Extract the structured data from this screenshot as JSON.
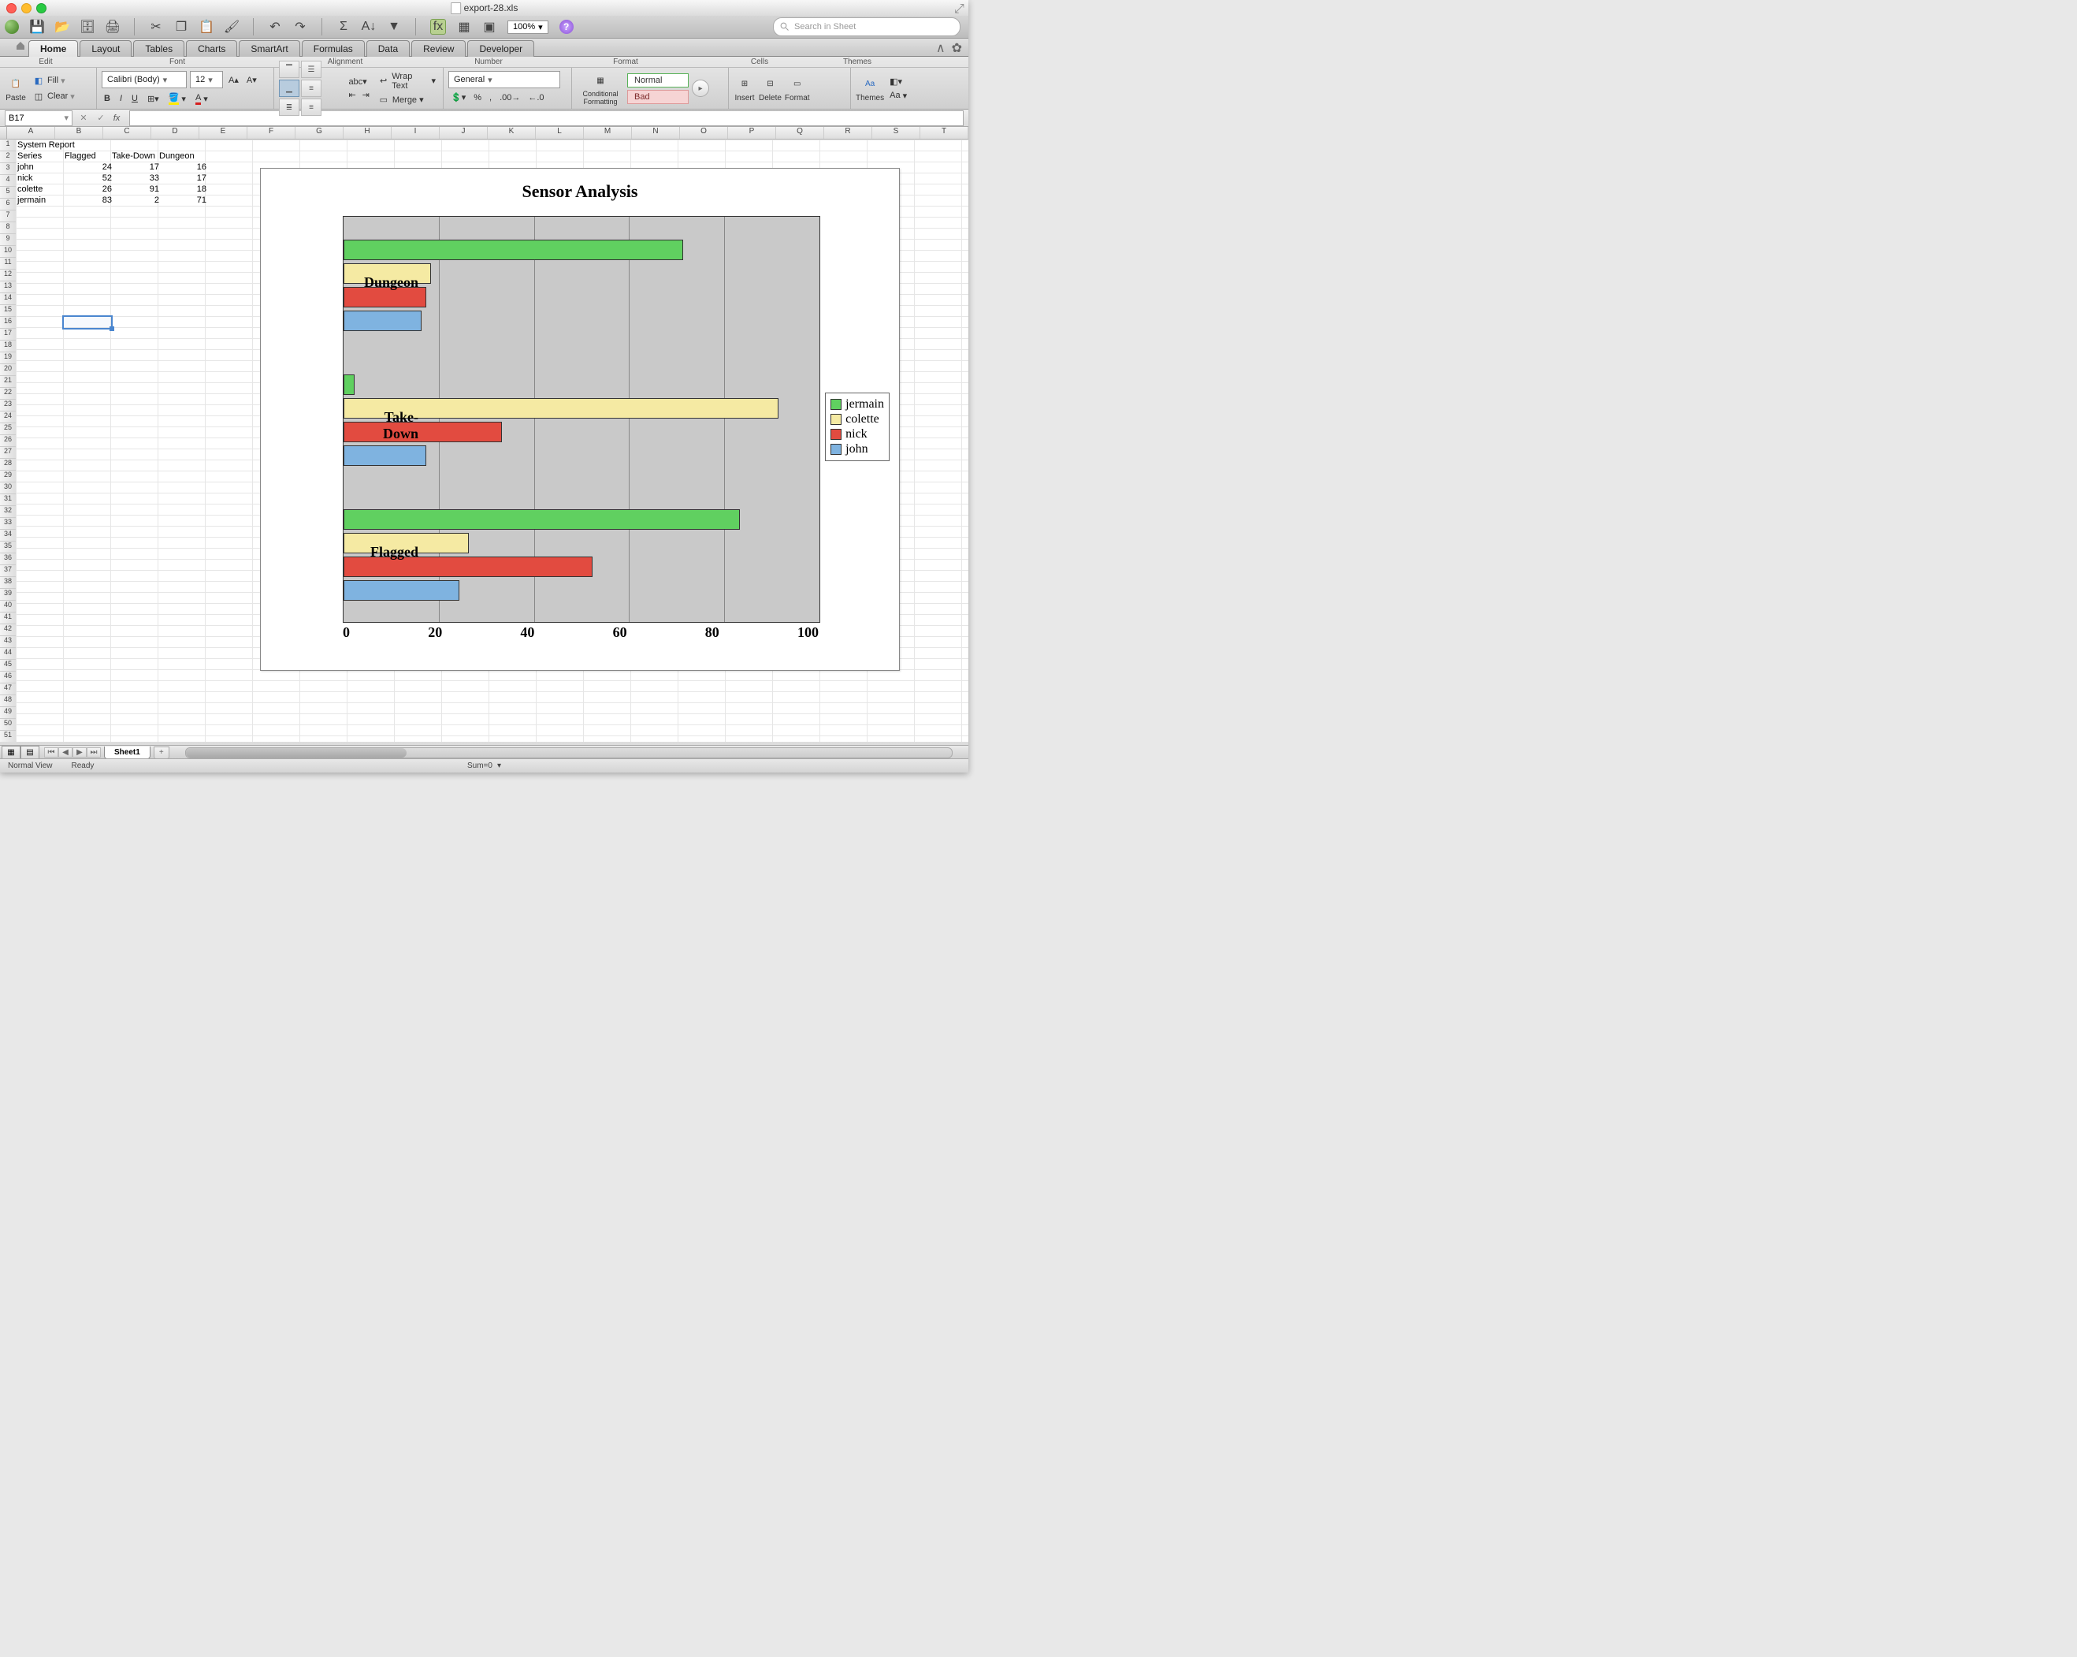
{
  "window": {
    "filename": "export-28.xls",
    "zoom": "100%",
    "search_placeholder": "Search in Sheet"
  },
  "tabs": [
    "Home",
    "Layout",
    "Tables",
    "Charts",
    "SmartArt",
    "Formulas",
    "Data",
    "Review",
    "Developer"
  ],
  "active_tab": "Home",
  "ribbon_groups": [
    "Edit",
    "Font",
    "Alignment",
    "Number",
    "Format",
    "Cells",
    "Themes"
  ],
  "ribbon": {
    "paste": "Paste",
    "fill": "Fill",
    "clear": "Clear",
    "font_name": "Calibri (Body)",
    "font_size": "12",
    "wrap": "Wrap Text",
    "merge": "Merge",
    "number_format": "General",
    "cond": "Conditional Formatting",
    "style_normal": "Normal",
    "style_bad": "Bad",
    "insert": "Insert",
    "delete": "Delete",
    "format": "Format",
    "themes": "Themes",
    "aa": "Aa"
  },
  "cell_ref": "B17",
  "selection": {
    "col": 1,
    "row": 16
  },
  "columns": [
    "A",
    "B",
    "C",
    "D",
    "E",
    "F",
    "G",
    "H",
    "I",
    "J",
    "K",
    "L",
    "M",
    "N",
    "O",
    "P",
    "Q",
    "R",
    "S",
    "T"
  ],
  "table": {
    "title": "System Report",
    "headers": [
      "Series",
      "Flagged",
      "Take-Down",
      "Dungeon"
    ],
    "rows": [
      [
        "john",
        "24",
        "17",
        "16"
      ],
      [
        "nick",
        "52",
        "33",
        "17"
      ],
      [
        "colette",
        "26",
        "91",
        "18"
      ],
      [
        "jermain",
        "83",
        "2",
        "71"
      ]
    ]
  },
  "chart_data": {
    "type": "bar",
    "orientation": "horizontal",
    "title": "Sensor Analysis",
    "categories": [
      "Dungeon",
      "Take-Down",
      "Flagged"
    ],
    "series": [
      {
        "name": "jermain",
        "values": [
          71,
          2,
          83
        ],
        "color": "#60d060"
      },
      {
        "name": "colette",
        "values": [
          18,
          91,
          26
        ],
        "color": "#f5eaa3"
      },
      {
        "name": "nick",
        "values": [
          17,
          33,
          52
        ],
        "color": "#e24b40"
      },
      {
        "name": "john",
        "values": [
          16,
          17,
          24
        ],
        "color": "#7fb3e0"
      }
    ],
    "x_ticks": [
      0,
      20,
      40,
      60,
      80,
      100
    ],
    "xlim": [
      0,
      100
    ]
  },
  "sheets": [
    "Sheet1"
  ],
  "status": {
    "view": "Normal View",
    "state": "Ready",
    "sum": "Sum=0"
  }
}
